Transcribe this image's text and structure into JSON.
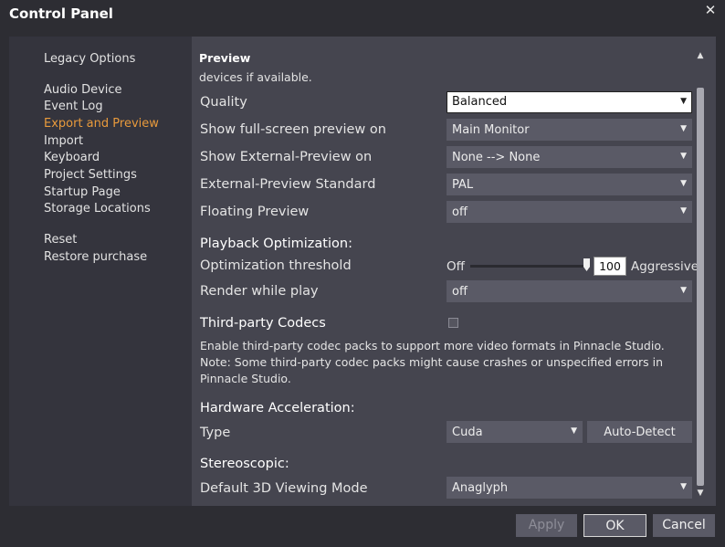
{
  "window": {
    "title": "Control Panel",
    "close_glyph": "✕"
  },
  "sidebar": {
    "items": [
      {
        "label": "Legacy Options"
      },
      {
        "label": "Audio Device"
      },
      {
        "label": "Event Log"
      },
      {
        "label": "Export and Preview",
        "active": true
      },
      {
        "label": "Import"
      },
      {
        "label": "Keyboard"
      },
      {
        "label": "Project Settings"
      },
      {
        "label": "Startup Page"
      },
      {
        "label": "Storage Locations"
      },
      {
        "label": "Reset"
      },
      {
        "label": "Restore purchase"
      }
    ]
  },
  "content": {
    "preview_heading": "Preview",
    "truncated_text": "devices if available.",
    "quality": {
      "label": "Quality",
      "value": "Balanced"
    },
    "fullscreen": {
      "label": "Show full-screen preview on",
      "value": "Main Monitor"
    },
    "external_preview": {
      "label": "Show External-Preview on",
      "value": "None --> None"
    },
    "external_standard": {
      "label": "External-Preview Standard",
      "value": "PAL"
    },
    "floating_preview": {
      "label": "Floating Preview",
      "value": "off"
    },
    "playback_heading": "Playback Optimization:",
    "optimization": {
      "label": "Optimization threshold",
      "min_label": "Off",
      "max_label": "Aggressive",
      "value": "100"
    },
    "render_while_play": {
      "label": "Render while play",
      "value": "off"
    },
    "codecs_heading": "Third-party Codecs",
    "codecs_description": "Enable third-party codec packs to support more video formats in Pinnacle Studio. Note: Some third-party codec packs might cause crashes or unspecified errors in Pinnacle Studio.",
    "hardware_heading": "Hardware Acceleration:",
    "type": {
      "label": "Type",
      "value": "Cuda",
      "auto_detect": "Auto-Detect"
    },
    "stereo_heading": "Stereoscopic:",
    "viewing_mode": {
      "label": "Default 3D Viewing Mode",
      "value": "Anaglyph"
    }
  },
  "footer": {
    "apply": "Apply",
    "ok": "OK",
    "cancel": "Cancel"
  },
  "glyphs": {
    "dropdown": "▼",
    "scroll_up": "▲",
    "scroll_down": "▼"
  },
  "colors": {
    "accent": "#e89a3c",
    "background": "#2d2d33",
    "panel": "#45454f",
    "sidebar": "#34343d"
  }
}
